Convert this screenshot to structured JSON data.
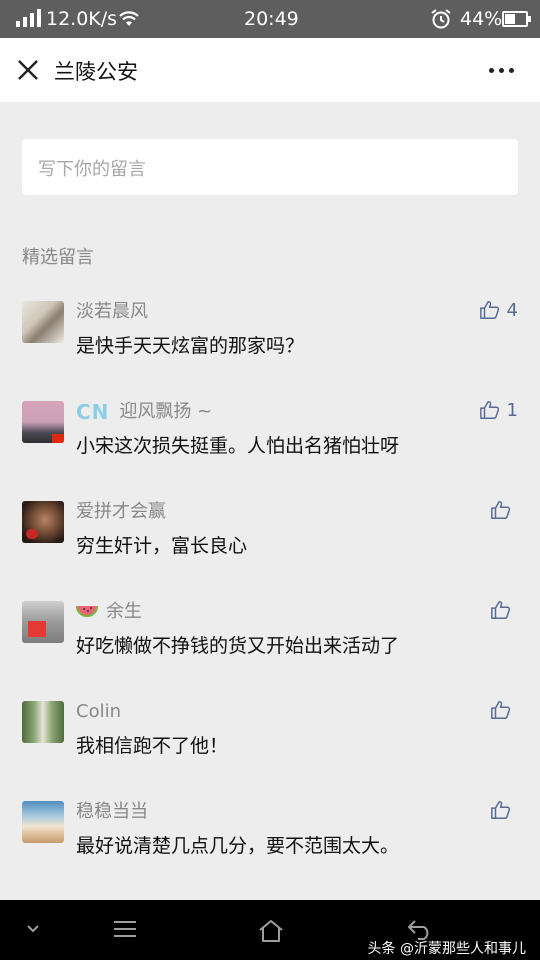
{
  "status": {
    "network_speed": "12.0K/s",
    "time": "20:49",
    "battery": "44%"
  },
  "nav": {
    "title": "兰陵公安"
  },
  "input": {
    "placeholder": "写下你的留言"
  },
  "section": {
    "title": "精选留言"
  },
  "comments": [
    {
      "name": "淡若晨风",
      "text": "是快手天天炫富的那家吗？",
      "likes": "4"
    },
    {
      "badge": "CN",
      "name": "迎风飘扬 ~",
      "text": "小宋这次损失挺重。人怕出名猪怕壮呀",
      "likes": "1"
    },
    {
      "name": "爱拼才会赢",
      "text": "穷生奸计，富长良心",
      "likes": ""
    },
    {
      "name": "余生",
      "text": "好吃懒做不挣钱的货又开始出来活动了",
      "likes": ""
    },
    {
      "name": "Colin",
      "text": "我相信跑不了他！",
      "likes": ""
    },
    {
      "name": "稳稳当当",
      "text": "最好说清楚几点几分，要不范围太大。",
      "likes": ""
    }
  ],
  "watermark": "头条 @沂蒙那些人和事儿",
  "colors": {
    "accent": "#576b95",
    "statusbar": "#5e5e5e",
    "background": "#ededed"
  }
}
